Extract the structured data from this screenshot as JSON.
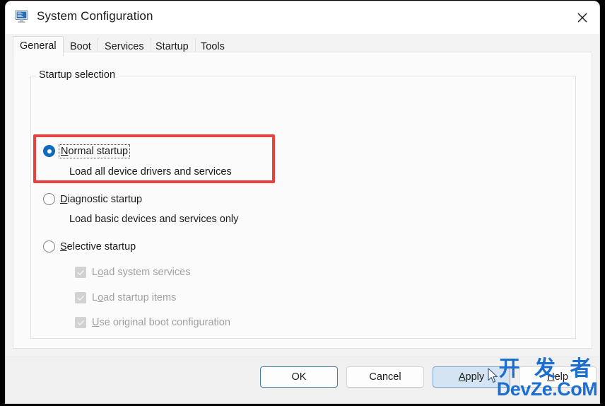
{
  "window": {
    "title": "System Configuration",
    "icon": "system-configuration-icon",
    "close_label": "✕"
  },
  "tabs": [
    {
      "label": "General",
      "active": true
    },
    {
      "label": "Boot",
      "active": false
    },
    {
      "label": "Services",
      "active": false
    },
    {
      "label": "Startup",
      "active": false
    },
    {
      "label": "Tools",
      "active": false
    }
  ],
  "group": {
    "label": "Startup selection"
  },
  "options": [
    {
      "akey": "N",
      "rest": "ormal startup",
      "description": "Load all device drivers and services",
      "selected": true,
      "focused": true,
      "highlighted": true
    },
    {
      "akey": "D",
      "rest": "iagnostic startup",
      "description": "Load basic devices and services only",
      "selected": false,
      "focused": false,
      "highlighted": false
    },
    {
      "akey": "S",
      "rest": "elective startup",
      "description": "",
      "selected": false,
      "focused": false,
      "highlighted": false
    }
  ],
  "checkboxes": [
    {
      "pre": "L",
      "akey": "o",
      "post": "ad system services",
      "checked": true,
      "disabled": true
    },
    {
      "pre": "L",
      "akey": "o",
      "post": "ad startup items",
      "checked": true,
      "disabled": true
    },
    {
      "pre": "",
      "akey": "U",
      "post": "se original boot configuration",
      "checked": true,
      "disabled": true
    }
  ],
  "buttons": [
    {
      "label": "OK",
      "state": "default"
    },
    {
      "label": "Cancel",
      "state": "normal"
    },
    {
      "label": "Apply",
      "akey": "A",
      "state": "hover"
    },
    {
      "label": "Help",
      "akey": "H",
      "state": "normal",
      "occluded": true
    }
  ],
  "watermark": {
    "top": "开 发 者",
    "bottom": "DevZe.CoM",
    "color": "#1c6fd0"
  },
  "colors": {
    "accent": "#0f6cbd",
    "highlight_box": "#e8423f",
    "titlebar": "#ffffff",
    "page": "#fbfbfb",
    "footer": "#f0f0f0"
  }
}
